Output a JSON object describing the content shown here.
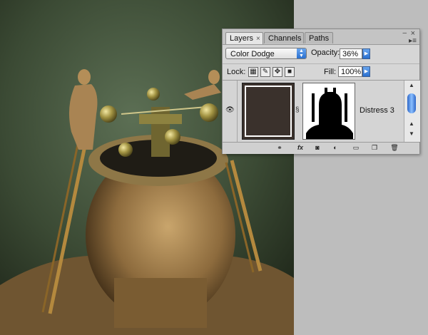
{
  "panel": {
    "tabs": [
      {
        "label": "Layers",
        "close": "×"
      },
      {
        "label": "Channels"
      },
      {
        "label": "Paths"
      }
    ],
    "window_close": "×",
    "window_collapse": "‒",
    "menu_icon": "▸≡",
    "blend_mode": "Color Dodge",
    "opacity_label": "Opacity:",
    "opacity_value": "36%",
    "lock_label": "Lock:",
    "fill_label": "Fill:",
    "fill_value": "100%",
    "layer": {
      "name": "Distress 3",
      "visible": true
    },
    "bottom_buttons": [
      "link-layers-icon",
      "fx-icon",
      "mask-icon",
      "adjustment-icon",
      "folder-icon",
      "new-layer-icon",
      "trash-icon"
    ],
    "fx_label": "fx"
  },
  "colors": {
    "scroll_accent": "#2a6fcf",
    "canvas_bg": "#bdbdbd"
  }
}
